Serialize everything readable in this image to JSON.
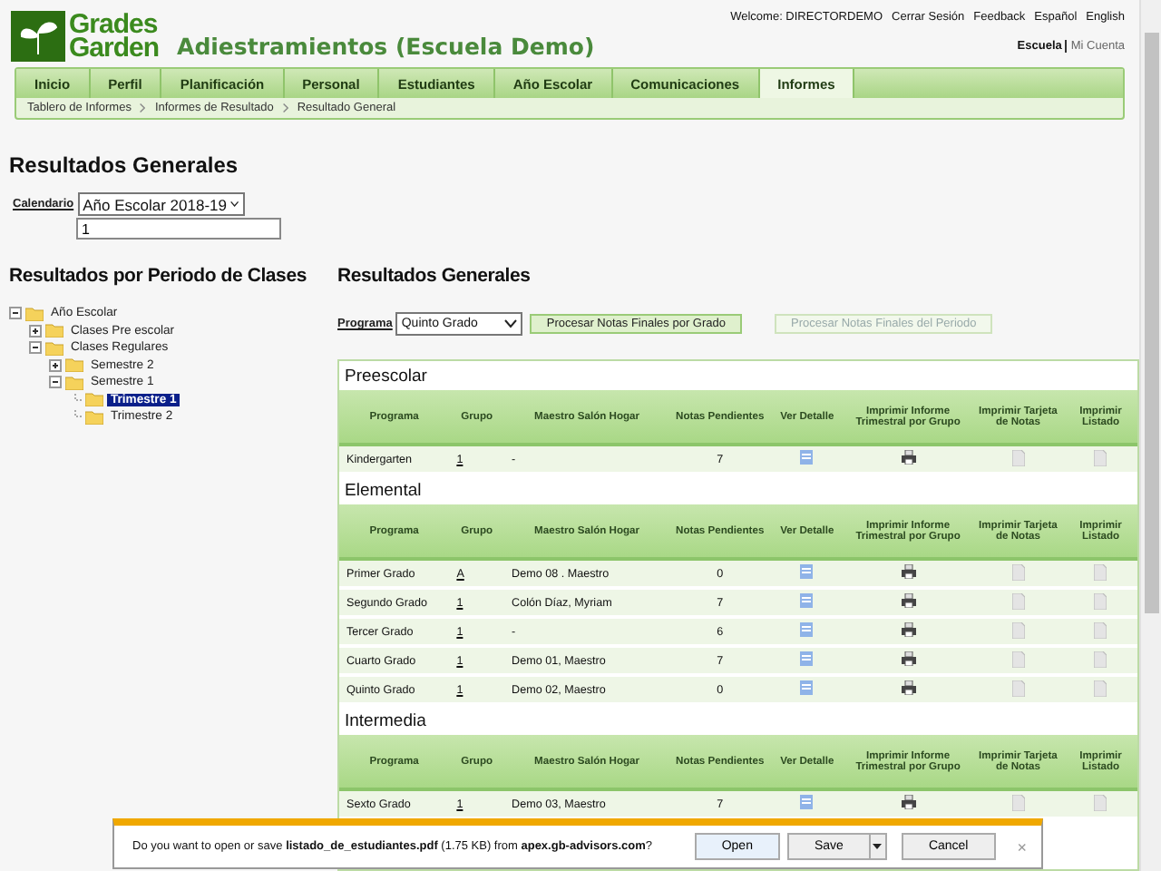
{
  "header": {
    "logo_top": "Grades",
    "logo_bottom": "Garden",
    "title": "Adiestramientos (Escuela Demo)",
    "welcome": "Welcome: DIRECTORDEMO",
    "top_links": [
      "Cerrar Sesión",
      "Feedback",
      "Español",
      "English"
    ],
    "account_links": [
      {
        "label": "Escuela",
        "selected": true
      },
      {
        "label": "Mi Cuenta",
        "selected": false
      }
    ]
  },
  "nav": [
    {
      "label": "Inicio",
      "selected": false
    },
    {
      "label": "Perfil",
      "selected": false
    },
    {
      "label": "Planificación",
      "selected": false
    },
    {
      "label": "Personal",
      "selected": false
    },
    {
      "label": "Estudiantes",
      "selected": false
    },
    {
      "label": "Año Escolar",
      "selected": false
    },
    {
      "label": "Comunicaciones",
      "selected": false
    },
    {
      "label": "Informes",
      "selected": true
    }
  ],
  "breadcrumb": [
    "Tablero de Informes",
    "Informes de Resultado",
    "Resultado General"
  ],
  "page_title": "Resultados Generales",
  "calendar": {
    "label": "Calendario",
    "value": "Año Escolar 2018-19",
    "input_value": "1"
  },
  "tree_title": "Resultados por Periodo de Clases",
  "tree": [
    {
      "label": "Año Escolar",
      "expanded": true,
      "selected": false,
      "children": [
        {
          "label": "Clases Pre escolar",
          "expanded": false,
          "selected": false
        },
        {
          "label": "Clases Regulares",
          "expanded": true,
          "selected": false,
          "children": [
            {
              "label": "Semestre 2",
              "expanded": false,
              "selected": false
            },
            {
              "label": "Semestre 1",
              "expanded": true,
              "selected": false,
              "children": [
                {
                  "label": "Trimestre 1",
                  "selected": true
                },
                {
                  "label": "Trimestre 2",
                  "selected": false
                }
              ]
            }
          ]
        }
      ]
    }
  ],
  "results_title": "Resultados Generales",
  "program": {
    "label": "Programa",
    "value": "Quinto Grado"
  },
  "buttons": [
    {
      "label": "Procesar Notas Finales por Grado",
      "disabled": false
    },
    {
      "label": "Procesar Notas Finales del Periodo",
      "disabled": true
    }
  ],
  "sections": [
    {
      "title": "Preescolar",
      "columns": [
        "Programa",
        "Grupo",
        "Maestro Salón Hogar",
        "Notas Pendientes",
        "Ver Detalle",
        "Imprimir Informe Trimestral por Grupo",
        "Imprimir Tarjeta de Notas",
        "Imprimir Listado"
      ],
      "rows": [
        {
          "programa": "Kindergarten",
          "grupo": "1",
          "maestro": "-",
          "notas": "7"
        }
      ]
    },
    {
      "title": "Elemental",
      "columns": [
        "Programa",
        "Grupo",
        "Maestro Salón Hogar",
        "Notas Pendientes",
        "Ver Detalle",
        "Imprimir Informe Trimestral por Grupo",
        "Imprimir Tarjeta de Notas",
        "Imprimir Listado"
      ],
      "rows": [
        {
          "programa": "Primer Grado",
          "grupo": "A",
          "maestro": "Demo 08 . Maestro",
          "notas": "0"
        },
        {
          "programa": "Segundo Grado",
          "grupo": "1",
          "maestro": "Colón Díaz, Myriam",
          "notas": "7"
        },
        {
          "programa": "Tercer Grado",
          "grupo": "1",
          "maestro": "-",
          "notas": "6"
        },
        {
          "programa": "Cuarto Grado",
          "grupo": "1",
          "maestro": "Demo 01, Maestro",
          "notas": "7"
        },
        {
          "programa": "Quinto Grado",
          "grupo": "1",
          "maestro": "Demo 02, Maestro",
          "notas": "0"
        }
      ]
    },
    {
      "title": "Intermedia",
      "columns": [
        "Programa",
        "Grupo",
        "Maestro Salón Hogar",
        "Notas Pendientes",
        "Ver Detalle",
        "Imprimir Informe Trimestral por Grupo",
        "Imprimir Tarjeta de Notas",
        "Imprimir Listado"
      ],
      "rows": [
        {
          "programa": "Sexto Grado",
          "grupo": "1",
          "maestro": "Demo 03, Maestro",
          "notas": "7"
        }
      ]
    }
  ],
  "download_bar": {
    "message": "Do you want to open or save **listado_de_estudiantes.pdf** (1.75 KB) from **apex.gb-advisors.com**?",
    "buttons": [
      "Open",
      "Save",
      "Cancel"
    ],
    "close": "×"
  }
}
